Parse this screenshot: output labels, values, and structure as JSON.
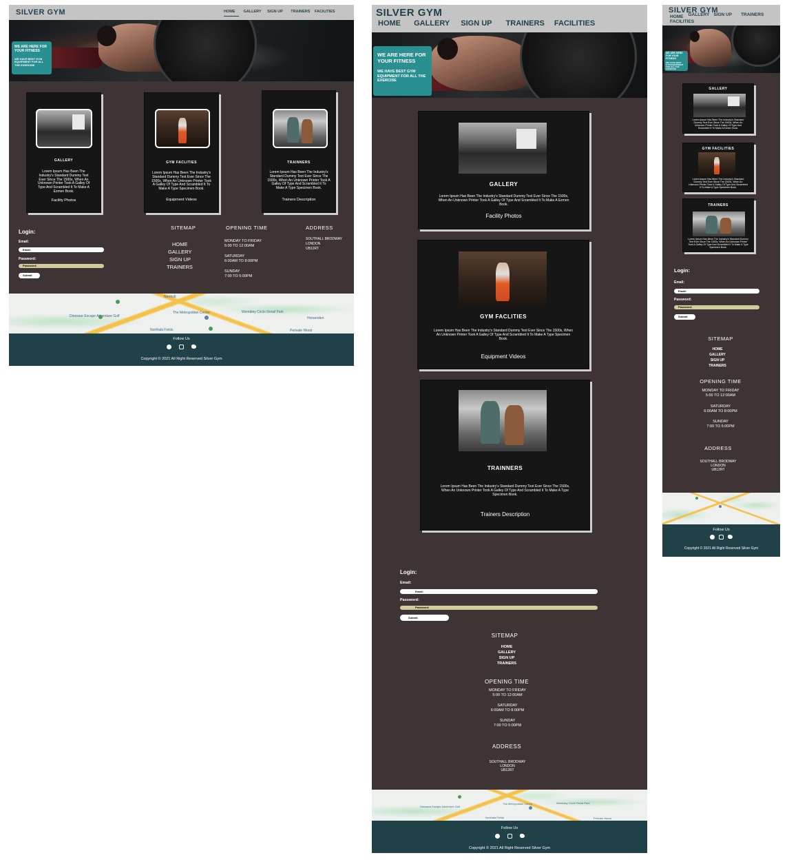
{
  "brand": "SILVER GYM",
  "nav": {
    "desktop": [
      "HOME",
      "GALLERY",
      "SIGN UP",
      "TRAINERS",
      "FACILITIES"
    ],
    "tablet": [
      "HOME",
      "GALLERY",
      "SIGN UP",
      "TRAINERS",
      "FACILITIES"
    ],
    "mobile": [
      "HOME",
      "GALLERY",
      "SIGN UP",
      "TRAINERS",
      "FACILITIES"
    ],
    "active": "HOME"
  },
  "hero": {
    "headline": "WE ARE HERE FOR YOUR FITNESS",
    "sub": "WE HAVE BEST GYM EQUIPMENT FOR ALL THE EXERCISE"
  },
  "cards": [
    {
      "title_desktop": "GALLERY",
      "title_tablet": "GALLERY",
      "body": "Lorem Ipsum Has Been The Industry's Standard Dummy Text Ever Since The 1500s, When An Unknown Printer Took A Galley Of Type And Scrambled It To Make A Ezmen Book.",
      "footer": "Facility Photos"
    },
    {
      "title_desktop": "GYM FACLITIES",
      "title_tablet": "GYM FACLITIES",
      "body": "Lorem Ipsum Has Been The Industry's Standard Dummy Text Ever Since The 1500s, When An Unknown Printer Took A Galley Of Type And Scrambled It To Make A Type Specimen Book.",
      "footer": "Equipment Videos"
    },
    {
      "title_desktop": "TRAINNERS",
      "title_tablet": "TRAINNERS",
      "body": "Lorem Ipsum Has Been The Industry's Standard Dummy Text Ever Since The 1500s, When An Unknown Printer Took A Galley Of Type And Scrambled It To Make A Type Specimen Book.",
      "footer": "Trainers Description"
    }
  ],
  "mobile_titles": [
    "GALLERY",
    "GYM FACILITIES",
    "TRAINERS"
  ],
  "login": {
    "title": "Login:",
    "email_label": "Email:",
    "email_placeholder": "Email:",
    "password_label": "Password:",
    "password_placeholder": "Password:",
    "submit": "Submit"
  },
  "sitemap": {
    "title": "SITEMAP",
    "links": [
      "HOME",
      "GALLERY",
      "SIGN UP",
      "TRAINERS"
    ]
  },
  "opening": {
    "title": "OPENING TIME",
    "lines": [
      "MONDAY TO FRIDAY",
      "5:00 TO 12:00AM",
      "SATURDAY",
      "6:00AM TO 8:00PM",
      "SUNDAY",
      "7:00 TO 5:00PM"
    ]
  },
  "address": {
    "title": "ADDRESS",
    "lines": [
      "SOUTHALL BRODWAY",
      "LONDON",
      "UB12RT"
    ]
  },
  "map_labels": [
    "Northolt",
    "The Metropolitan Centre",
    "Dinosaur Escape Adventure Golf",
    "Northala Fields",
    "Wembley Circle Retail Park",
    "Horsenden",
    "Perivale Wood"
  ],
  "footer": {
    "follow": "Follow Us",
    "icons": [
      "facebook-icon",
      "instagram-icon",
      "twitter-icon"
    ],
    "copyright": "Copyright © 2021 All Right Reserved Silver Gym"
  },
  "colors": {
    "nav_bg": "#c4c4c4",
    "brand": "#1f3f49",
    "main_bg": "#3e3435",
    "card_bg": "#161616",
    "hero_box": "#2a8f91",
    "password_field": "#d1cb9a",
    "footer_bg": "#1f4147"
  }
}
